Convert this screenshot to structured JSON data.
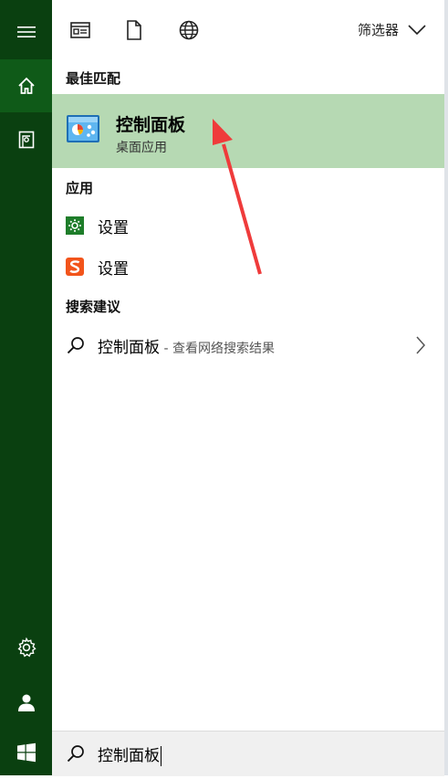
{
  "sidebar": {
    "items": [
      {
        "name": "hamburger-icon"
      },
      {
        "name": "home-icon"
      },
      {
        "name": "notebook-icon"
      },
      {
        "name": "gear-icon"
      },
      {
        "name": "user-icon"
      },
      {
        "name": "windows-icon"
      }
    ]
  },
  "topbar": {
    "icons": [
      "document-view-icon",
      "file-icon",
      "globe-icon"
    ],
    "filter_label": "筛选器",
    "filter_icon": "chevron-down-icon"
  },
  "best_match": {
    "header": "最佳匹配",
    "title": "控制面板",
    "subtitle": "桌面应用",
    "icon": "control-panel-icon"
  },
  "apps": {
    "header": "应用",
    "items": [
      {
        "label": "设置",
        "icon": "green-gear-icon"
      },
      {
        "label": "设置",
        "icon": "sogou-s-icon"
      }
    ]
  },
  "suggestions": {
    "header": "搜索建议",
    "items": [
      {
        "query": "控制面板",
        "sub": " - 查看网络搜索结果",
        "icon": "search-icon"
      }
    ]
  },
  "search": {
    "value": "控制面板",
    "icon": "search-icon"
  },
  "colors": {
    "rail": "#0a4010",
    "rail_active": "#0f5a18",
    "highlight": "#b6d9b3",
    "annotation": "#ef3b3b"
  }
}
